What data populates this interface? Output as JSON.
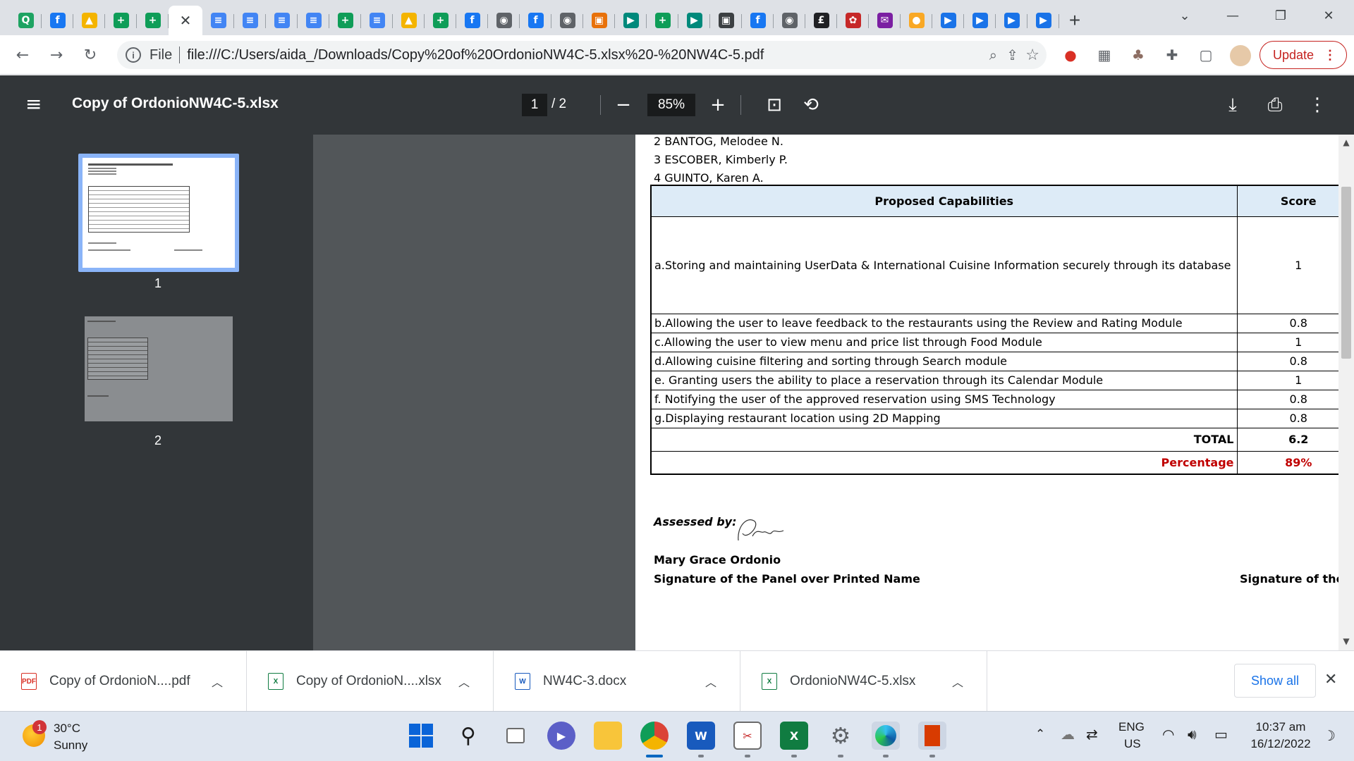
{
  "browser": {
    "tabs": [
      {
        "icon": "qualys-icon",
        "glyph": "Q",
        "color": "#1ea362",
        "active": false
      },
      {
        "icon": "facebook-icon",
        "glyph": "f",
        "color": "#1877f2",
        "active": false
      },
      {
        "icon": "google-drive-icon",
        "glyph": "▲",
        "color": "#f4b400",
        "active": false
      },
      {
        "icon": "google-sheets-icon",
        "glyph": "+",
        "color": "#0f9d58",
        "active": false
      },
      {
        "icon": "google-sheets-icon",
        "glyph": "+",
        "color": "#0f9d58",
        "active": false
      },
      {
        "icon": "close-icon",
        "glyph": "✕",
        "color": "",
        "active": true
      },
      {
        "icon": "google-docs-icon",
        "glyph": "≡",
        "color": "#4285f4",
        "active": false
      },
      {
        "icon": "google-docs-icon",
        "glyph": "≡",
        "color": "#4285f4",
        "active": false
      },
      {
        "icon": "google-docs-icon",
        "glyph": "≡",
        "color": "#4285f4",
        "active": false
      },
      {
        "icon": "google-docs-icon",
        "glyph": "≡",
        "color": "#4285f4",
        "active": false
      },
      {
        "icon": "google-sheets-icon",
        "glyph": "+",
        "color": "#0f9d58",
        "active": false
      },
      {
        "icon": "google-docs-icon",
        "glyph": "≡",
        "color": "#4285f4",
        "active": false
      },
      {
        "icon": "google-drive-icon",
        "glyph": "▲",
        "color": "#f4b400",
        "active": false
      },
      {
        "icon": "google-sheets-icon",
        "glyph": "+",
        "color": "#0f9d58",
        "active": false
      },
      {
        "icon": "facebook-icon",
        "glyph": "f",
        "color": "#1877f2",
        "active": false
      },
      {
        "icon": "globe-icon",
        "glyph": "◉",
        "color": "#5f6368",
        "active": false
      },
      {
        "icon": "facebook-icon",
        "glyph": "f",
        "color": "#1877f2",
        "active": false
      },
      {
        "icon": "globe-icon",
        "glyph": "◉",
        "color": "#5f6368",
        "active": false
      },
      {
        "icon": "contacts-icon",
        "glyph": "▣",
        "color": "#e8710a",
        "active": false
      },
      {
        "icon": "google-meet-icon",
        "glyph": "▶",
        "color": "#00897b",
        "active": false
      },
      {
        "icon": "google-sheets-icon",
        "glyph": "+",
        "color": "#0f9d58",
        "active": false
      },
      {
        "icon": "google-meet-icon",
        "glyph": "▶",
        "color": "#00897b",
        "active": false
      },
      {
        "icon": "classroom-icon",
        "glyph": "▣",
        "color": "#3c4043",
        "active": false
      },
      {
        "icon": "facebook-icon",
        "glyph": "f",
        "color": "#1877f2",
        "active": false
      },
      {
        "icon": "globe-icon",
        "glyph": "◉",
        "color": "#5f6368",
        "active": false
      },
      {
        "icon": "pound-icon",
        "glyph": "£",
        "color": "#202124",
        "active": false
      },
      {
        "icon": "seal-icon",
        "glyph": "✿",
        "color": "#c62828",
        "active": false
      },
      {
        "icon": "mail-icon",
        "glyph": "✉",
        "color": "#7b1fa2",
        "active": false
      },
      {
        "icon": "coin-icon",
        "glyph": "●",
        "color": "#f9a825",
        "active": false
      },
      {
        "icon": "play-icon",
        "glyph": "▶",
        "color": "#1a73e8",
        "active": false
      },
      {
        "icon": "play-icon",
        "glyph": "▶",
        "color": "#1a73e8",
        "active": false
      },
      {
        "icon": "play-icon",
        "glyph": "▶",
        "color": "#1a73e8",
        "active": false
      },
      {
        "icon": "play-icon",
        "glyph": "▶",
        "color": "#1a73e8",
        "active": false
      }
    ],
    "new_tab": "+",
    "address": {
      "scheme": "File",
      "url": "file:///C:/Users/aida_/Downloads/Copy%20of%20OrdonioNW4C-5.xlsx%20-%20NW4C-5.pdf"
    },
    "update_label": "Update"
  },
  "pdf": {
    "title": "Copy of OrdonioNW4C-5.xlsx",
    "current_page": "1",
    "total_pages": "/ 2",
    "zoom": "85%",
    "thumbnails": [
      {
        "label": "1"
      },
      {
        "label": "2"
      }
    ]
  },
  "document": {
    "members": [
      "2 BANTOG, Melodee N.",
      "3 ESCOBER, Kimberly P.",
      "4 GUINTO, Karen A."
    ],
    "table": {
      "header_capability": "Proposed Capabilities",
      "header_score": "Score",
      "rows": [
        {
          "capability": "a.Storing and maintaining UserData & International Cuisine Information securely through its database",
          "score": "1"
        },
        {
          "capability": "b.Allowing the user to leave feedback to the restaurants using the Review and Rating Module",
          "score": "0.8"
        },
        {
          "capability": "c.Allowing the user to view menu and price list through Food Module",
          "score": "1"
        },
        {
          "capability": "d.Allowing cuisine filtering and sorting through Search module",
          "score": "0.8"
        },
        {
          "capability": "e. Granting users the ability to place a reservation through its Calendar Module",
          "score": "1"
        },
        {
          "capability": "f. Notifying the user of the approved reservation using SMS Technology",
          "score": "0.8"
        },
        {
          "capability": "g.Displaying restaurant location using 2D Mapping",
          "score": "0.8"
        }
      ],
      "total_label": "TOTAL",
      "total_value": "6.2",
      "percentage_label": "Percentage",
      "percentage_value": "89%"
    },
    "assessed_by": "Assessed by:",
    "signature_text": "Mdonio",
    "assessor_name": "Mary Grace Ordonio",
    "sig_panel_printed": "Signature of the Panel over Printed Name",
    "sig_panel": "Signature of the Pane"
  },
  "downloads": {
    "items": [
      {
        "name": "Copy of OrdonioN....pdf",
        "kind": "pdf"
      },
      {
        "name": "Copy of OrdonioN....xlsx",
        "kind": "xlsx"
      },
      {
        "name": "NW4C-3.docx",
        "kind": "docx"
      },
      {
        "name": "OrdonioNW4C-5.xlsx",
        "kind": "xlsx"
      }
    ],
    "show_all": "Show all"
  },
  "taskbar": {
    "weather_temp": "30°C",
    "weather_desc": "Sunny",
    "weather_badge": "1",
    "lang_top": "ENG",
    "lang_bottom": "US",
    "time": "10:37 am",
    "date": "16/12/2022"
  }
}
